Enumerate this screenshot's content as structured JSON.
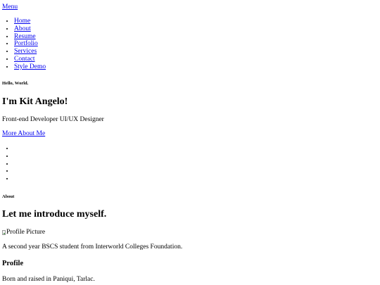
{
  "header": {
    "menu_label": "Menu"
  },
  "nav": {
    "items": [
      {
        "label": "Home"
      },
      {
        "label": "About"
      },
      {
        "label": "Resume"
      },
      {
        "label": "Portfolio"
      },
      {
        "label": "Services"
      },
      {
        "label": "Contact"
      },
      {
        "label": "Style Demo"
      }
    ]
  },
  "hero": {
    "greeting": "Hello, World.",
    "title": "I'm Kit Angelo!",
    "roles": "Front-end Developer UI/UX Designer",
    "cta_label": "More About Me",
    "social_item_count": 5
  },
  "about": {
    "label": "About",
    "title": "Let me introduce myself.",
    "profile_image_alt": "Profile Picture",
    "description": "A second year BSCS student from Interworld Colleges Foundation.",
    "profile_heading": "Profile",
    "origin": "Born and raised in Paniqui, Tarlac."
  },
  "colors": {
    "link": "#0000ee",
    "text": "#000000",
    "background": "#ffffff"
  }
}
